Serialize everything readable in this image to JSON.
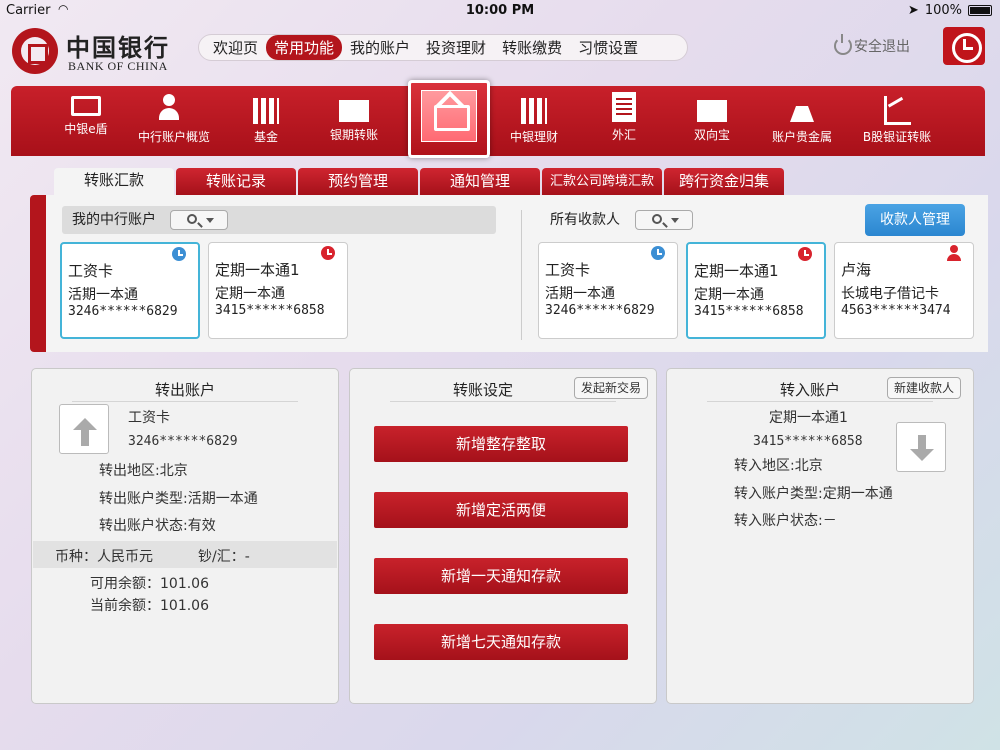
{
  "status_bar": {
    "carrier": "Carrier",
    "time": "10:00 PM",
    "battery": "100%"
  },
  "logo": {
    "cn": "中国银行",
    "en": "BANK OF CHINA"
  },
  "top_nav": [
    "欢迎页",
    "常用功能",
    "我的账户",
    "投资理财",
    "转账缴费",
    "习惯设置"
  ],
  "top_nav_active": "常用功能",
  "logout": "安全退出",
  "func_bar": {
    "items": [
      "中银e盾",
      "中行账户概览",
      "基金",
      "银期转账",
      "中银理财",
      "外汇",
      "双向宝",
      "账户贵金属",
      "B股银证转账"
    ],
    "active_icon": "transfer-icon"
  },
  "sub_tabs": [
    "转账汇款",
    "转账记录",
    "预约管理",
    "通知管理",
    "汇款公司跨境汇款",
    "跨行资金归集"
  ],
  "my_accounts": {
    "label": "我的中行账户",
    "cards": [
      {
        "name": "工资卡",
        "type": "活期一本通",
        "number": "3246******6829",
        "badge": "clock-icon-blue"
      },
      {
        "name": "定期一本通1",
        "type": "定期一本通",
        "number": "3415******6858",
        "badge": "clock-icon-red"
      }
    ]
  },
  "payees": {
    "label": "所有收款人",
    "manage_button": "收款人管理",
    "cards": [
      {
        "name": "工资卡",
        "type": "活期一本通",
        "number": "3246******6829",
        "badge": "clock-icon-blue"
      },
      {
        "name": "定期一本通1",
        "type": "定期一本通",
        "number": "3415******6858",
        "badge": "clock-icon-red"
      },
      {
        "name": "卢海",
        "type": "长城电子借记卡",
        "number": "4563******3474",
        "badge": "person-icon"
      }
    ]
  },
  "out_account": {
    "title": "转出账户",
    "name": "工资卡",
    "number": "3246******6829",
    "region": "转出地区:北京",
    "acct_type": "转出账户类型:活期一本通",
    "acct_status": "转出账户状态:有效",
    "currency": "币种：人民币元",
    "cash_remit": "钞/汇：-",
    "available": "可用余额：101.06",
    "current": "当前余额：101.06"
  },
  "transfer_settings": {
    "title": "转账设定",
    "new_trade": "发起新交易",
    "buttons": [
      "新增整存整取",
      "新增定活两便",
      "新增一天通知存款",
      "新增七天通知存款"
    ]
  },
  "in_account": {
    "title": "转入账户",
    "new_payee": "新建收款人",
    "name": "定期一本通1",
    "number": "3415******6858",
    "region": "转入地区:北京",
    "acct_type": "转入账户类型:定期一本通",
    "acct_status": "转入账户状态:－"
  },
  "colors": {
    "brand_red": "#b3151c",
    "accent_blue": "#2b86d0",
    "selected_border": "#44b4d8"
  }
}
